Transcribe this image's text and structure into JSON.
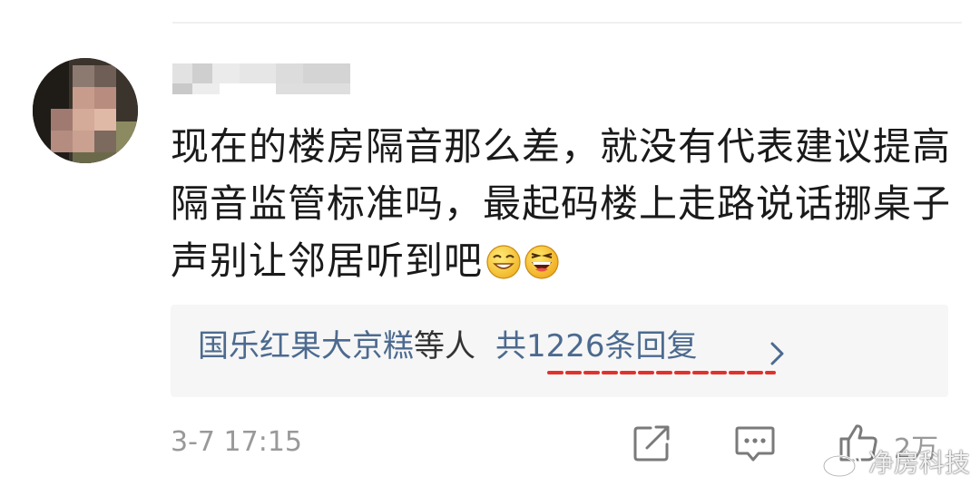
{
  "comment": {
    "text": "现在的楼房隔音那么差，就没有代表建议提高隔音监管标准吗，最起码楼上走路说话挪桌子声别让邻居听到吧",
    "emojis": [
      "grin-emoji",
      "laugh-emoji"
    ]
  },
  "reply": {
    "names": "国乐红果大京糕",
    "suffix": "等人",
    "count": "共1226条回复",
    "highlight_color": "#e0322d"
  },
  "footer": {
    "timestamp": "3-7 17:15",
    "likes": "2万"
  },
  "watermark": {
    "text": "净房科技"
  },
  "colors": {
    "link": "#4c6a8f",
    "text": "#1a1a1a",
    "muted": "#999999",
    "reply_bg": "#f6f6f6"
  }
}
